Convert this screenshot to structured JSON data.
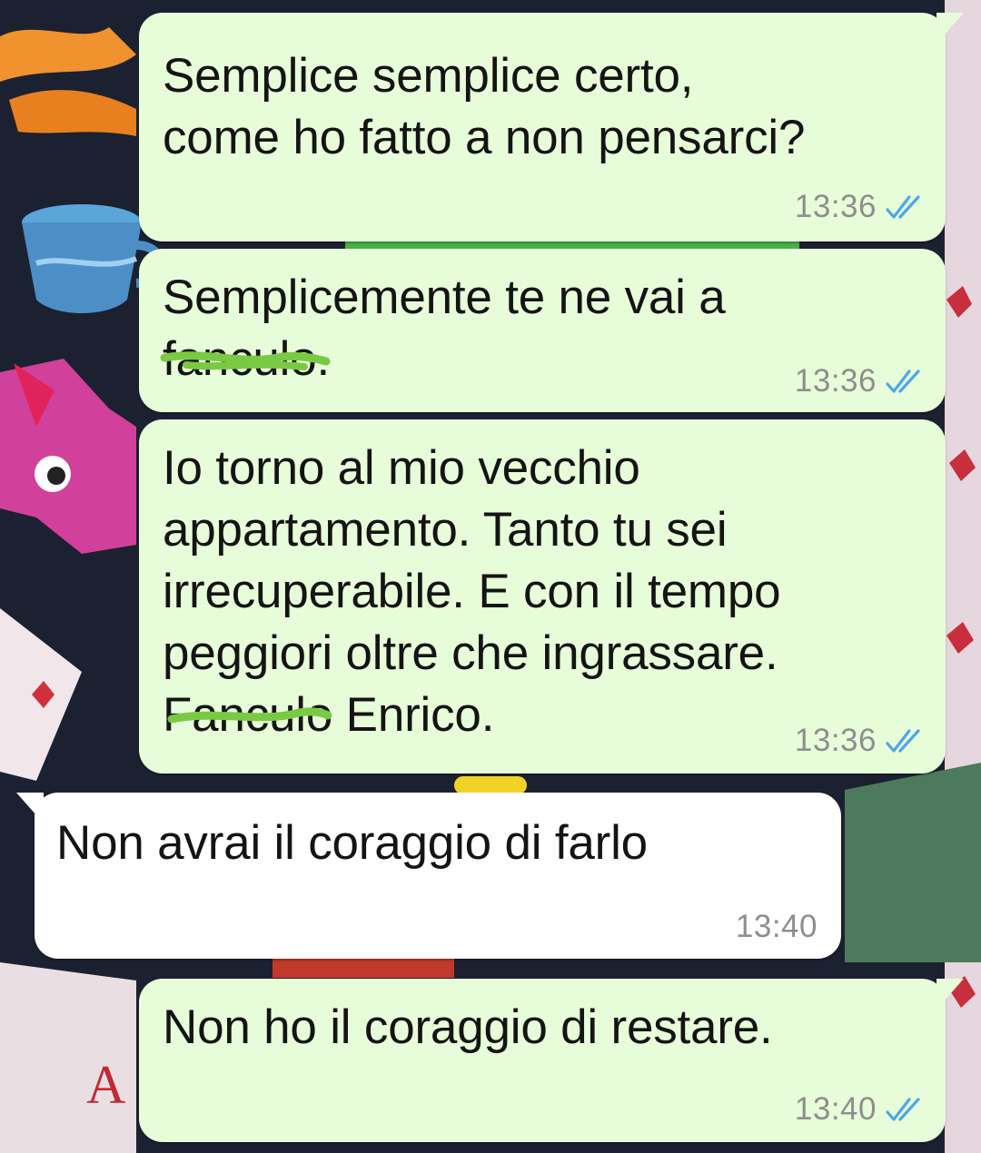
{
  "chat": {
    "messages": [
      {
        "direction": "outgoing",
        "lines": [
          "Semplice semplice certo,",
          "come ho fatto a non pensarci?"
        ],
        "time": "13:36",
        "status": "read"
      },
      {
        "direction": "outgoing",
        "line1": "Semplicemente te ne vai a",
        "line2_redacted": "fanculo",
        "line2_rest": ".",
        "time": "13:36",
        "status": "read"
      },
      {
        "direction": "outgoing",
        "lines": [
          "Io torno al mio vecchio",
          "appartamento. Tanto tu sei",
          "irrecuperabile. E con il tempo",
          "peggiori oltre che ingrassare."
        ],
        "last_line_redacted": "Fanculo",
        "last_line_rest": " Enrico.",
        "time": "13:36",
        "status": "read"
      },
      {
        "direction": "incoming",
        "lines": [
          "Non avrai il coraggio di farlo"
        ],
        "time": "13:40"
      },
      {
        "direction": "outgoing",
        "lines": [
          "Non ho il coraggio di restare."
        ],
        "time": "13:40",
        "status": "read"
      }
    ]
  },
  "icons": {
    "read_receipt": "double-check-icon",
    "redaction": "green-scribble"
  },
  "colors": {
    "outgoing_bubble": "#e7fdd9",
    "incoming_bubble": "#ffffff",
    "read_tick": "#4fa6e6",
    "time_text": "#8e8e8e",
    "redaction_scribble": "#7ac943"
  }
}
